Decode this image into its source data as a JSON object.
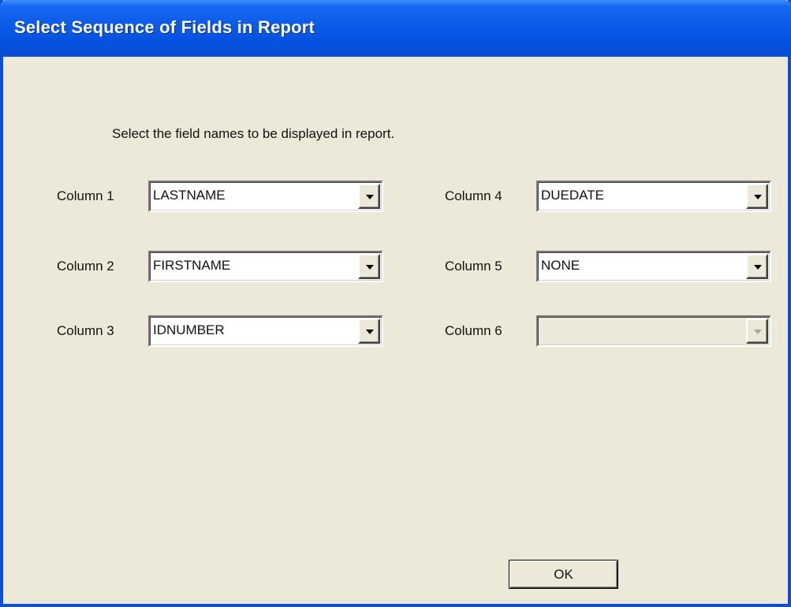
{
  "window": {
    "title": "Select Sequence of Fields in Report"
  },
  "instruction": "Select the field names to be displayed in report.",
  "columns": [
    {
      "label": "Column 1",
      "value": "LASTNAME",
      "enabled": true
    },
    {
      "label": "Column 2",
      "value": "FIRSTNAME",
      "enabled": true
    },
    {
      "label": "Column 3",
      "value": "IDNUMBER",
      "enabled": true
    },
    {
      "label": "Column 4",
      "value": "DUEDATE",
      "enabled": true
    },
    {
      "label": "Column 5",
      "value": "NONE",
      "enabled": true
    },
    {
      "label": "Column 6",
      "value": "",
      "enabled": false
    }
  ],
  "buttons": {
    "ok_label": "OK"
  },
  "colors": {
    "titlebar": "#0b5be8",
    "dialog_background": "#ece9d8"
  },
  "icons": {
    "dropdown": "chevron-down-icon"
  }
}
